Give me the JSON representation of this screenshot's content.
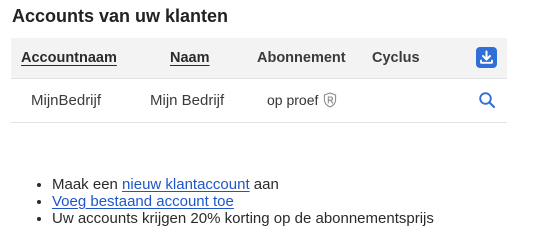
{
  "page": {
    "title": "Accounts van uw klanten"
  },
  "table": {
    "headers": {
      "account_name": "Accountnaam",
      "name": "Naam",
      "subscription": "Abonnement",
      "cycle": "Cyclus"
    },
    "download_icon": "download-icon",
    "rows": [
      {
        "account_name": "MijnBedrijf",
        "name": "Mijn Bedrijf",
        "subscription": "op proef",
        "subscription_icon": "shield-r-icon",
        "cycle": "",
        "action_icon": "search-icon"
      }
    ]
  },
  "info": {
    "item1_prefix": "Maak een ",
    "item1_link": "nieuw klantaccount",
    "item1_suffix": " aan",
    "item2_link": "Voeg bestaand account toe",
    "item3": "Uw accounts krijgen 20% korting op de abonnementsprijs"
  },
  "colors": {
    "accent": "#2f6fd6",
    "link": "#1e56c9",
    "header_bg": "#f3f3f4"
  }
}
